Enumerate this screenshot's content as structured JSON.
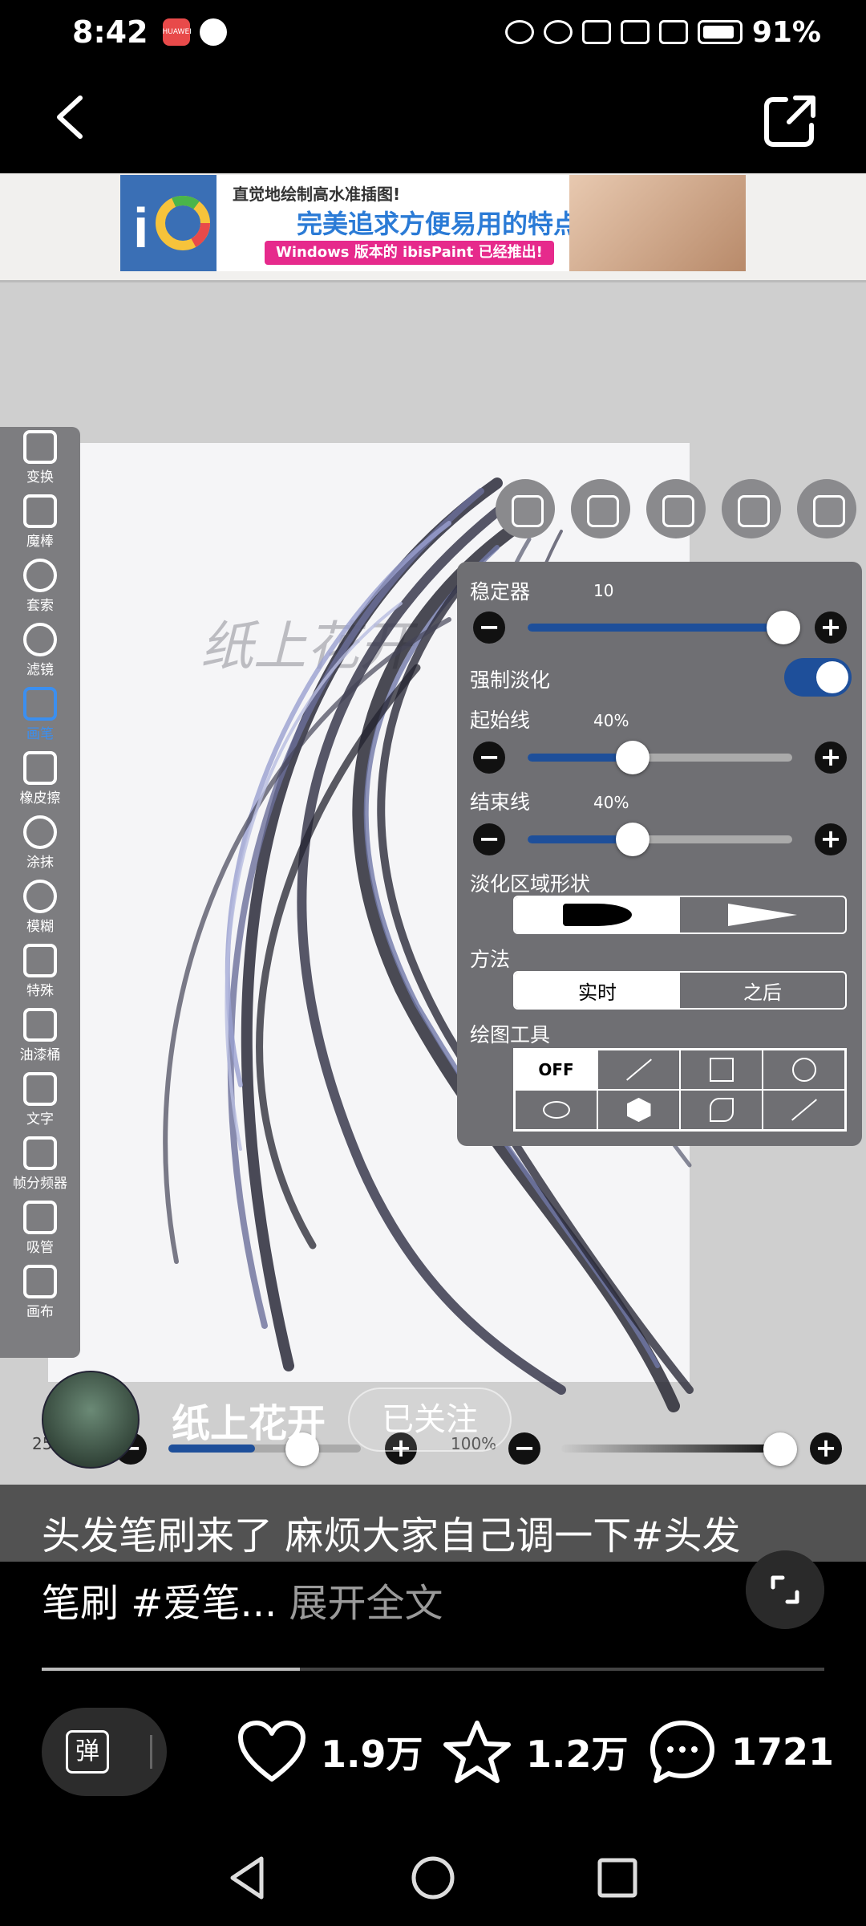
{
  "status_bar": {
    "time": "8:42",
    "app_badge": "HUAWEI",
    "battery": "91%"
  },
  "ad": {
    "line1": "直觉地绘制高水准插图!",
    "line2": "完美追求方便易用的特点!",
    "line3": "Windows 版本的 ibisPaint 已经推出!"
  },
  "canvas": {
    "watermark": "纸上花开"
  },
  "toolbar": {
    "tools": [
      {
        "label": "变换"
      },
      {
        "label": "魔棒"
      },
      {
        "label": "套索"
      },
      {
        "label": "滤镜"
      },
      {
        "label": "画笔"
      },
      {
        "label": "橡皮擦"
      },
      {
        "label": "涂抹"
      },
      {
        "label": "模糊"
      },
      {
        "label": "特殊"
      },
      {
        "label": "油漆桶"
      },
      {
        "label": "文字"
      },
      {
        "label": "帧分频器"
      },
      {
        "label": "吸管"
      },
      {
        "label": "画布"
      }
    ]
  },
  "panel": {
    "stabilizer_label": "稳定器",
    "stabilizer_value": "10",
    "force_fade_label": "强制淡化",
    "start_label": "起始线",
    "start_value": "40%",
    "end_label": "结束线",
    "end_value": "40%",
    "fade_shape_label": "淡化区域形状",
    "method_label": "方法",
    "method_options": [
      "实时",
      "之后"
    ],
    "drawing_tool_label": "绘图工具",
    "drawing_tools_off": "OFF"
  },
  "bottom_controls": {
    "size_value": "250",
    "opacity_value": "100%"
  },
  "author": {
    "name": "纸上花开",
    "follow_label": "已关注"
  },
  "caption": {
    "text": "头发笔刷来了 麻烦大家自己调一下#头发笔刷 #爱笔...",
    "more": "展开全文"
  },
  "progress": {
    "fraction": 0.33
  },
  "actions": {
    "danmu_label": "弹",
    "likes": "1.9万",
    "favorites": "1.2万",
    "comments": "1721"
  },
  "colors": {
    "accent": "#1e4f9a",
    "active_tool": "#3b8ff0"
  }
}
